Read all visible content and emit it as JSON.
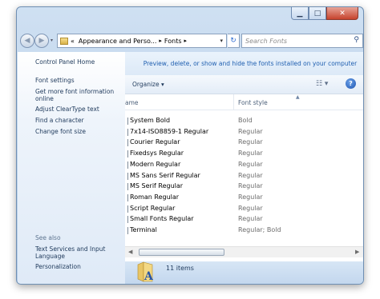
{
  "window": {
    "buttons": {
      "minimize": "▁",
      "maximize": "□",
      "close": "✕"
    }
  },
  "nav": {
    "back": "◀",
    "forward": "▶",
    "dropdown": "▾",
    "address": {
      "prefix": "«",
      "crumbs": [
        "Appearance and Perso...",
        "Fonts"
      ],
      "separator": "▸",
      "dropdown": "▾"
    },
    "refresh": "↻",
    "search": {
      "placeholder": "Search Fonts",
      "icon": "⚲"
    }
  },
  "sidebar": {
    "home": "Control Panel Home",
    "tasks": [
      "Font settings",
      "Get more font information online",
      "Adjust ClearType text",
      "Find a character",
      "Change font size"
    ],
    "see_also_label": "See also",
    "see_also": [
      "Text Services and Input Language",
      "Personalization"
    ]
  },
  "main": {
    "infobar": "Preview, delete, or show and hide the fonts installed on your computer",
    "toolbar": {
      "organize": "Organize ▾",
      "views": "☷ ▾",
      "help": "?"
    },
    "columns": {
      "name": "ame",
      "style": "Font style",
      "sort": "▲"
    },
    "fonts": [
      {
        "name": "System Bold",
        "style": "Bold"
      },
      {
        "name": "7x14-ISO8859-1 Regular",
        "style": "Regular"
      },
      {
        "name": "Courier Regular",
        "style": "Regular"
      },
      {
        "name": "Fixedsys Regular",
        "style": "Regular"
      },
      {
        "name": "Modern Regular",
        "style": "Regular"
      },
      {
        "name": "MS Sans Serif Regular",
        "style": "Regular"
      },
      {
        "name": "MS Serif Regular",
        "style": "Regular"
      },
      {
        "name": "Roman Regular",
        "style": "Regular"
      },
      {
        "name": "Script Regular",
        "style": "Regular"
      },
      {
        "name": "Small Fonts Regular",
        "style": "Regular"
      },
      {
        "name": "Terminal",
        "style": "Regular; Bold"
      }
    ],
    "scroll": {
      "left": "◀",
      "right": "▶"
    }
  },
  "details": {
    "count": "11 items",
    "icon_letter": "A"
  },
  "colors": {
    "link": "#1e395b",
    "infobar_text": "#1f5fb0",
    "frame": "#bcd3ec"
  }
}
